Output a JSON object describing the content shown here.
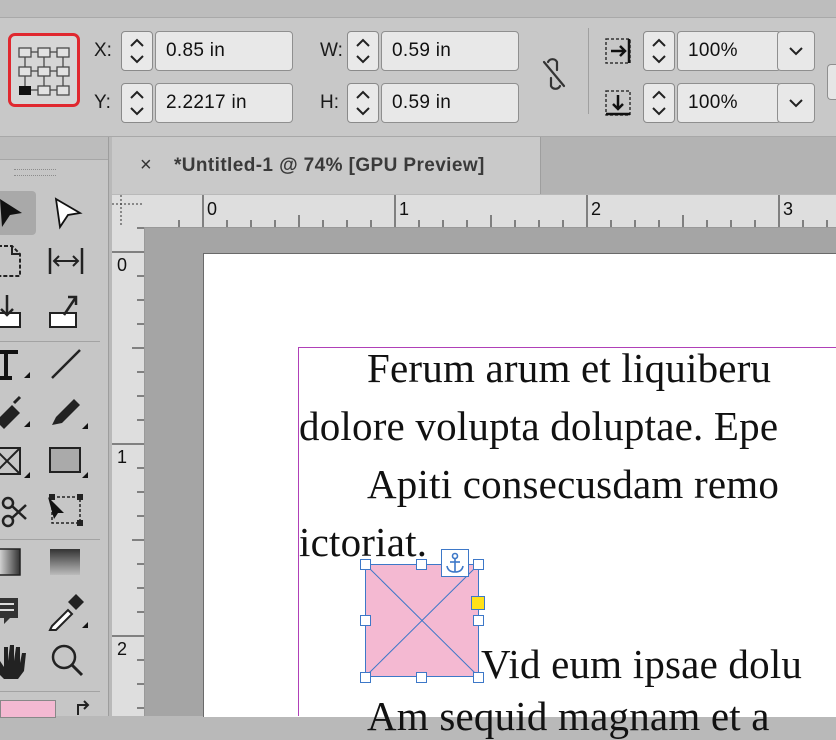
{
  "control_panel": {
    "x_label": "X:",
    "x_value": "0.85 in",
    "y_label": "Y:",
    "y_value": "2.2217 in",
    "w_label": "W:",
    "w_value": "0.59 in",
    "h_label": "H:",
    "h_value": "0.59 in",
    "scale_x_value": "100%",
    "scale_y_value": "100%",
    "reference_point_selected": "bottom-left"
  },
  "document_tab": {
    "close_glyph": "×",
    "title": "*Untitled-1 @ 74% [GPU Preview]"
  },
  "rulers": {
    "horizontal": [
      "0",
      "1",
      "2",
      "3"
    ],
    "vertical": [
      "0",
      "1",
      "2"
    ]
  },
  "text_lines": [
    "Ferum arum et liquiberu",
    "dolore volupta doluptae. Epe",
    "Apiti consecusdam remo",
    "ictoriat.",
    "Vid eum ipsae dolu",
    "Am sequid magnam et a"
  ],
  "colors": {
    "selection_outline": "#e0282f",
    "frame_fill": "#f4b9d2",
    "frame_stroke": "#3d78c8",
    "margin_guide": "#b040b8",
    "overset_port": "#ffe11a"
  }
}
